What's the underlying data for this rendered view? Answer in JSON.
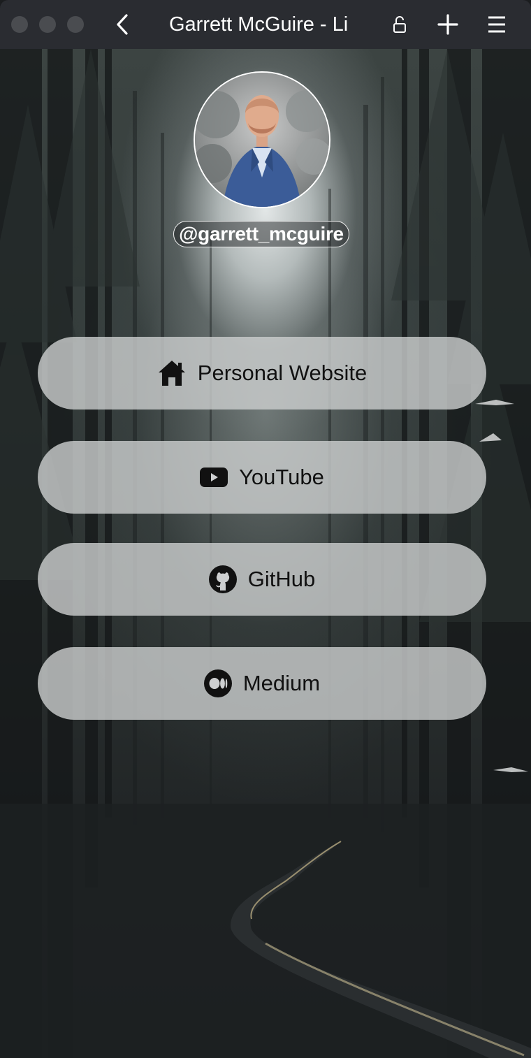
{
  "window": {
    "title": "Garrett McGuire - Li",
    "icons": {
      "back": "chevron-left-icon",
      "lock": "lock-open-icon",
      "new_tab": "plus-icon",
      "menu": "hamburger-menu-icon"
    }
  },
  "profile": {
    "username": "@garrett_mcguire",
    "avatar": "profile-photo"
  },
  "links": [
    {
      "label": "Personal Website",
      "icon": "home-icon"
    },
    {
      "label": "YouTube",
      "icon": "youtube-icon"
    },
    {
      "label": "GitHub",
      "icon": "github-icon"
    },
    {
      "label": "Medium",
      "icon": "medium-icon"
    }
  ],
  "colors": {
    "titlebar": "#2a2c31",
    "button_fill": "#cdcfd0",
    "button_text": "#111111"
  }
}
